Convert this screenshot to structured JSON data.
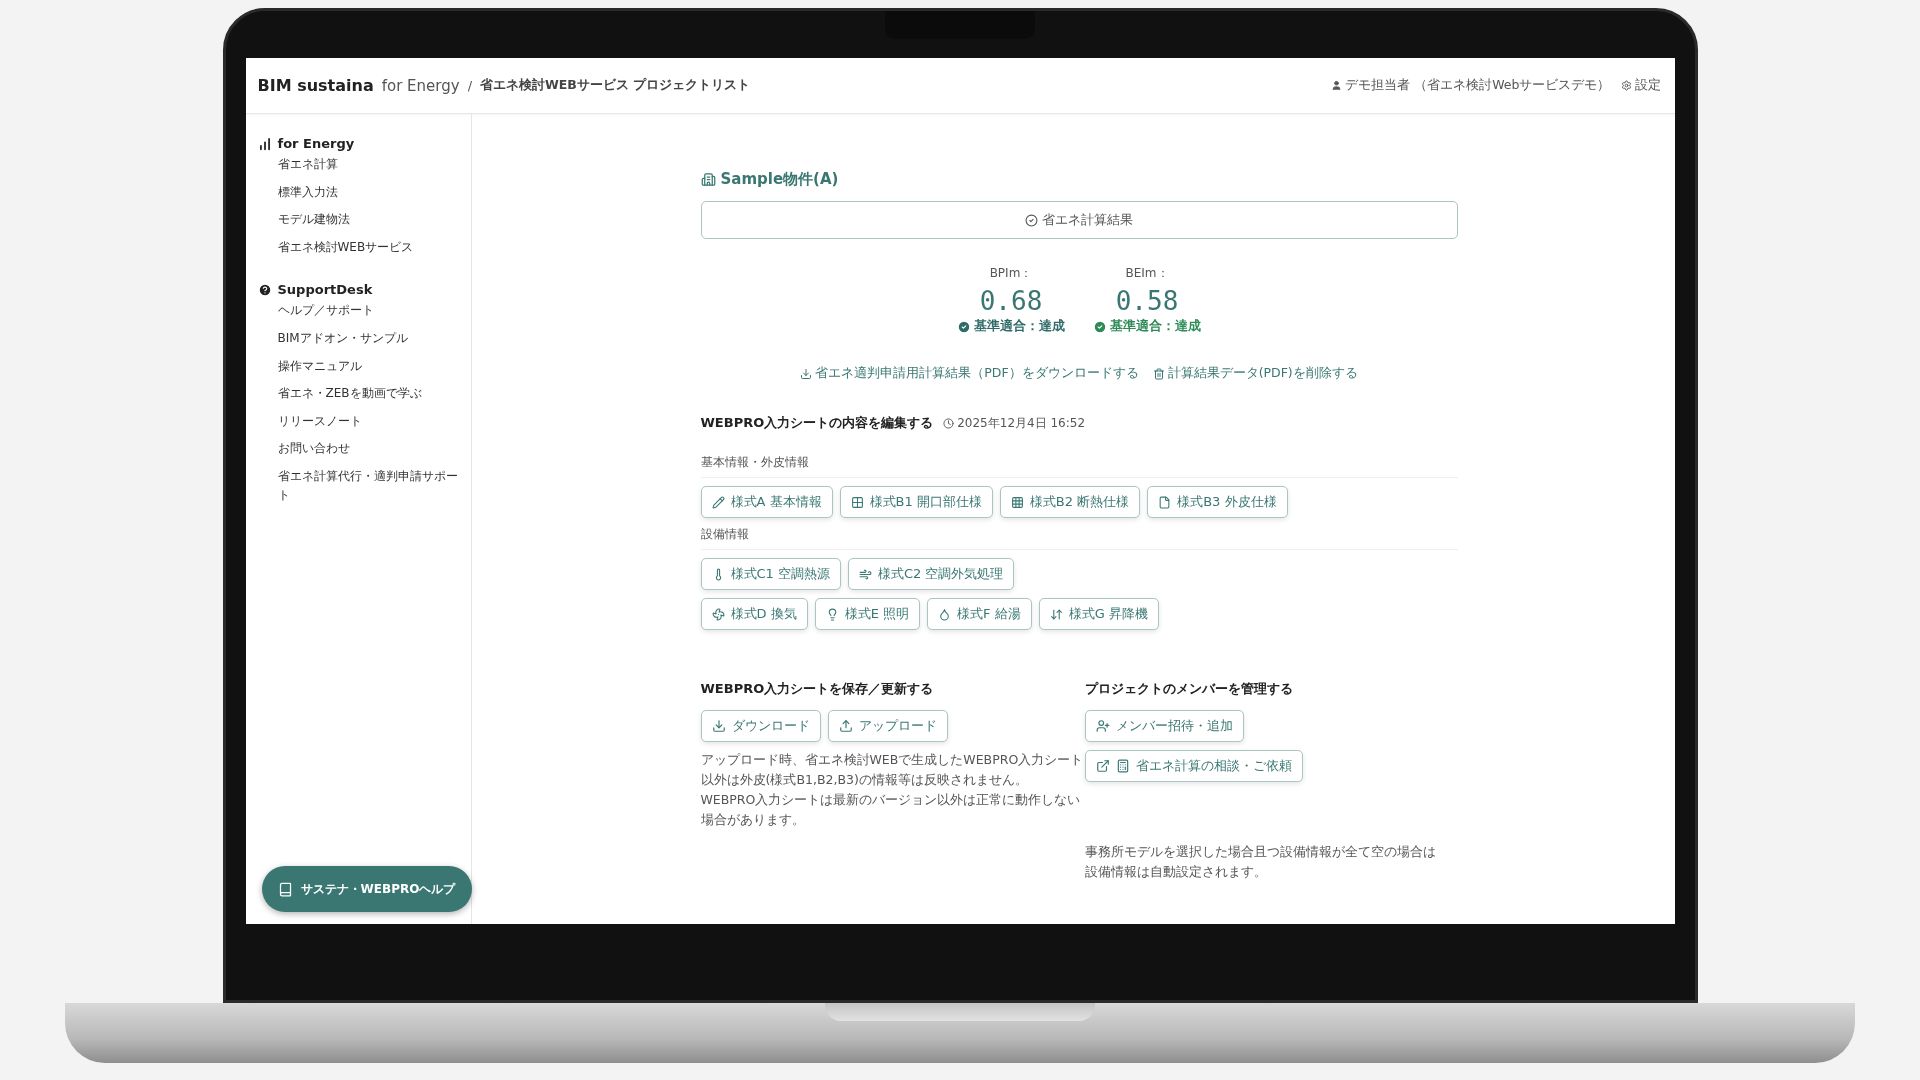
{
  "header": {
    "brand": "BIM sustaina",
    "brand_sub": "for Energy",
    "separator": "/",
    "breadcrumb": "省エネ検討WEBサービス プロジェクトリスト",
    "user": "デモ担当者 （省エネ検討Webサービスデモ）",
    "settings": "設定"
  },
  "sidebar": {
    "sections": [
      {
        "kind": "energy",
        "title": "for Energy",
        "items": [
          "省エネ計算",
          "標準入力法",
          "モデル建物法",
          "省エネ検討WEBサービス"
        ]
      },
      {
        "kind": "support",
        "title": "SupportDesk",
        "items": [
          "ヘルプ／サポート",
          "BIMアドオン・サンプル",
          "操作マニュアル",
          "省エネ・ZEBを動画で学ぶ",
          "リリースノート",
          "お問い合わせ",
          "省エネ計算代行・適判申請サポート"
        ]
      }
    ],
    "help_button": "サステナ・WEBPROヘルプ"
  },
  "project": {
    "title": "Sample物件(A)",
    "result_button": "省エネ計算結果",
    "metrics": [
      {
        "label": "BPIm：",
        "value": "0.68",
        "status": "基準適合：達成",
        "color": "#2f6b68"
      },
      {
        "label": "BEIm：",
        "value": "0.58",
        "status": "基準適合：達成",
        "color": "#2e8b57"
      }
    ],
    "links": [
      "省エネ適判申請用計算結果（PDF）をダウンロードする",
      "計算結果データ(PDF)を削除する"
    ]
  },
  "edit": {
    "title": "WEBPRO入力シートの内容を編集する",
    "timestamp": "2025年12月4日 16:52",
    "groups": [
      {
        "title": "基本情報・外皮情報",
        "rows": [
          [
            "様式A 基本情報",
            "様式B1 開口部仕様",
            "様式B2 断熱仕様",
            "様式B3 外皮仕様"
          ]
        ]
      },
      {
        "title": "設備情報",
        "rows": [
          [
            "様式C1 空調熱源",
            "様式C2 空調外気処理"
          ],
          [
            "様式D 換気",
            "様式E 照明",
            "様式F 給湯",
            "様式G 昇降機"
          ]
        ]
      }
    ]
  },
  "save": {
    "title": "WEBPRO入力シートを保存／更新する",
    "buttons": [
      "ダウンロード",
      "アップロード"
    ],
    "note": "アップロード時、省エネ検討WEBで生成したWEBPRO入力シート以外は外皮(様式B1,B2,B3)の情報等は反映されません。 WEBPRO入力シートは最新のバージョン以外は正常に動作しない場合があります。"
  },
  "members": {
    "title": "プロジェクトのメンバーを管理する",
    "buttons": [
      "メンバー招待・追加",
      "省エネ計算の相談・ご依頼"
    ],
    "footnote": [
      "事務所モデルを選択した場合且つ設備情報が全て空の場合は",
      "設備情報は自動設定されます。"
    ]
  }
}
